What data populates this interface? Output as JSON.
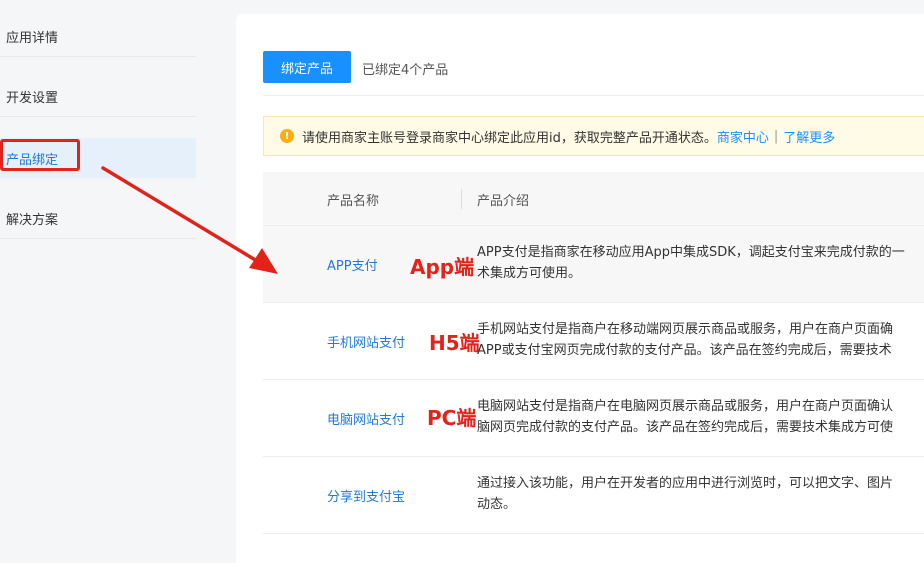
{
  "sidebar": {
    "items": [
      {
        "label": "应用详情"
      },
      {
        "label": "开发设置"
      },
      {
        "label": "产品绑定"
      },
      {
        "label": "解决方案"
      }
    ]
  },
  "toolbar": {
    "bind_label": "绑定产品",
    "bound_count": "已绑定4个产品"
  },
  "alert": {
    "text": "请使用商家主账号登录商家中心绑定此应用id，获取完整产品开通状态。",
    "link1": "商家中心",
    "separator": "|",
    "link2": "了解更多"
  },
  "table": {
    "headers": [
      "产品名称",
      "产品介绍"
    ],
    "rows": [
      {
        "name": "APP支付",
        "desc_line1": "APP支付是指商家在移动应用App中集成SDK，调起支付宝来完成付款的一",
        "desc_line2": "术集成方可使用。",
        "annotation": "App端"
      },
      {
        "name": "手机网站支付",
        "desc_line1": "手机网站支付是指商户在移动端网页展示商品或服务，用户在商户页面确",
        "desc_line2": "APP或支付宝网页完成付款的支付产品。该产品在签约完成后，需要技术",
        "annotation": "H5端"
      },
      {
        "name": "电脑网站支付",
        "desc_line1": "电脑网站支付是指商户在电脑网页展示商品或服务，用户在商户页面确认",
        "desc_line2": "脑网页完成付款的支付产品。该产品在签约完成后，需要技术集成方可使",
        "annotation": "PC端"
      },
      {
        "name": "分享到支付宝",
        "desc_line1": "通过接入该功能，用户在开发者的应用中进行浏览时，可以把文字、图片",
        "desc_line2": "动态。",
        "annotation": ""
      }
    ]
  },
  "colors": {
    "accent": "#1890ff",
    "annotation_red": "#e2231a",
    "alert_bg": "#fffbe6"
  }
}
